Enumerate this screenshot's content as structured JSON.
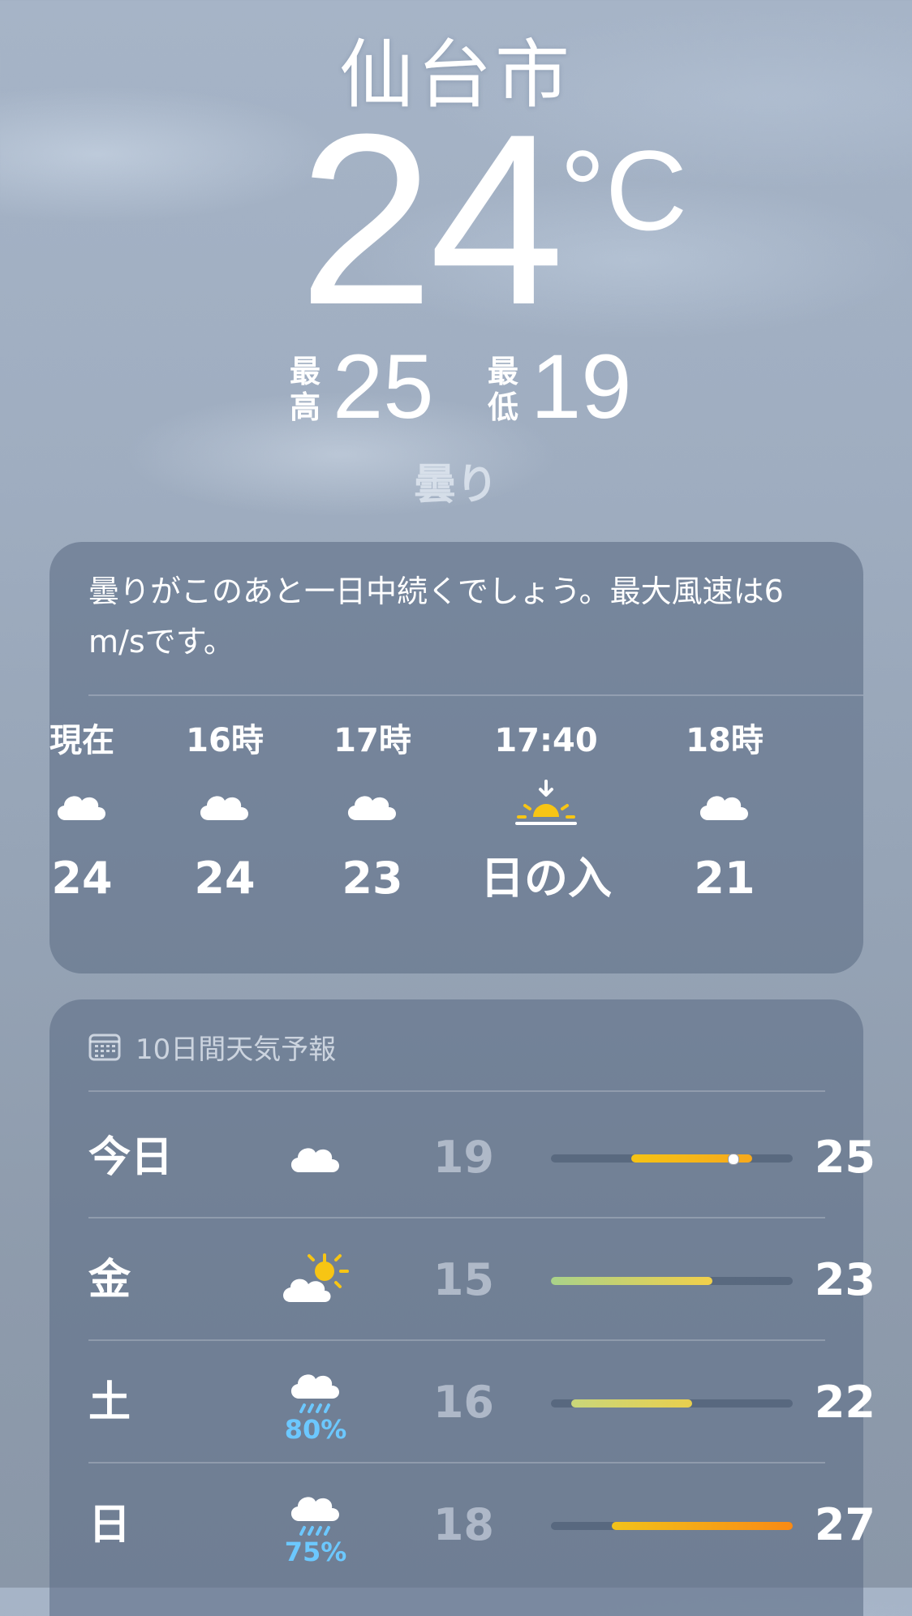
{
  "location": {
    "city": "仙台市",
    "temperature": "24",
    "unit": "°C",
    "high_label": "最高",
    "high": "25",
    "low_label": "最低",
    "low": "19",
    "condition": "曇り"
  },
  "hourly": {
    "summary": "曇りがこのあと一日中続くでしょう。最大風速は6 m/sです。",
    "items": [
      {
        "time": "現在",
        "icon": "cloud-icon",
        "value": "24"
      },
      {
        "time": "16時",
        "icon": "cloud-icon",
        "value": "24"
      },
      {
        "time": "17時",
        "icon": "cloud-icon",
        "value": "23"
      },
      {
        "time": "17:40",
        "icon": "sunset-icon",
        "value": "日の入"
      },
      {
        "time": "18時",
        "icon": "cloud-icon",
        "value": "21"
      }
    ]
  },
  "daily": {
    "header": "10日間天気予報",
    "range_min": 15,
    "range_max": 27,
    "items": [
      {
        "day": "今日",
        "icon": "cloud-icon",
        "precip": "",
        "low": "19",
        "high": "25",
        "lo_val": 19,
        "hi_val": 25,
        "current": 24,
        "colors": [
          "#f5c314",
          "#f7a91c"
        ]
      },
      {
        "day": "金",
        "icon": "partly-sunny-icon",
        "precip": "",
        "low": "15",
        "high": "23",
        "lo_val": 15,
        "hi_val": 23,
        "colors": [
          "#a9d28a",
          "#f2d04a"
        ]
      },
      {
        "day": "土",
        "icon": "rain-cloud-icon",
        "precip": "80%",
        "low": "16",
        "high": "22",
        "lo_val": 16,
        "hi_val": 22,
        "colors": [
          "#c9d67a",
          "#e9cf4e"
        ]
      },
      {
        "day": "日",
        "icon": "rain-cloud-icon",
        "precip": "75%",
        "low": "18",
        "high": "27",
        "lo_val": 18,
        "hi_val": 27,
        "colors": [
          "#f2c21a",
          "#f98a14"
        ]
      }
    ]
  }
}
